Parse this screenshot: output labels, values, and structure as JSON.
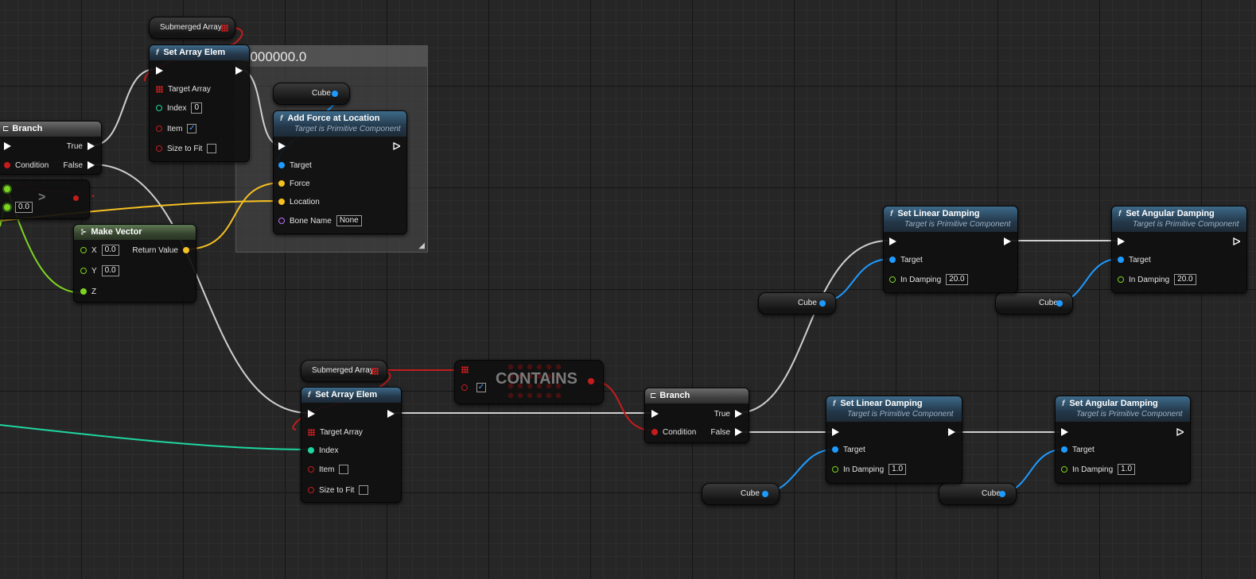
{
  "comment_box": {
    "title": "1000000.0"
  },
  "nodes": {
    "submerged_array_top": {
      "label": "Submerged Array"
    },
    "set_array_elem_top": {
      "title": "Set Array Elem",
      "pins": {
        "target_array": "Target Array",
        "index": "Index",
        "item": "Item",
        "size_to_fit": "Size to Fit"
      },
      "index_value": "0",
      "item_checked": "✓",
      "size_to_fit_checked": ""
    },
    "cube_top": {
      "label": "Cube"
    },
    "add_force": {
      "title": "Add Force at Location",
      "subtitle": "Target is Primitive Component",
      "pins": {
        "target": "Target",
        "force": "Force",
        "location": "Location",
        "bone_name": "Bone Name"
      },
      "bone_name_value": "None"
    },
    "branch_left": {
      "title": "Branch",
      "pins": {
        "true": "True",
        "condition": "Condition",
        "false": "False"
      }
    },
    "compare_node": {
      "value": "0.0",
      "symbol": ">"
    },
    "make_vector": {
      "title": "Make Vector",
      "pins": {
        "x": "X",
        "y": "Y",
        "z": "Z",
        "return_value": "Return Value"
      },
      "x_value": "0.0",
      "y_value": "0.0"
    },
    "submerged_array_bottom": {
      "label": "Submerged Array"
    },
    "contains": {
      "label": "CONTAINS",
      "checked": "✓"
    },
    "set_array_elem_bottom": {
      "title": "Set Array Elem",
      "pins": {
        "target_array": "Target Array",
        "index": "Index",
        "item": "Item",
        "size_to_fit": "Size to Fit"
      },
      "item_checked": "",
      "size_to_fit_checked": ""
    },
    "branch_right": {
      "title": "Branch",
      "pins": {
        "true": "True",
        "condition": "Condition",
        "false": "False"
      }
    },
    "set_linear_damping_top": {
      "title": "Set Linear Damping",
      "subtitle": "Target is Primitive Component",
      "pins": {
        "target": "Target",
        "in_damping": "In Damping"
      },
      "damping_value": "20.0"
    },
    "set_angular_damping_top": {
      "title": "Set Angular Damping",
      "subtitle": "Target is Primitive Component",
      "pins": {
        "target": "Target",
        "in_damping": "In Damping"
      },
      "damping_value": "20.0"
    },
    "set_linear_damping_bottom": {
      "title": "Set Linear Damping",
      "subtitle": "Target is Primitive Component",
      "pins": {
        "target": "Target",
        "in_damping": "In Damping"
      },
      "damping_value": "1.0"
    },
    "set_angular_damping_bottom": {
      "title": "Set Angular Damping",
      "subtitle": "Target is Primitive Component",
      "pins": {
        "target": "Target",
        "in_damping": "In Damping"
      },
      "damping_value": "1.0"
    },
    "cube_linear_top": {
      "label": "Cube"
    },
    "cube_angular_top": {
      "label": "Cube"
    },
    "cube_linear_bottom": {
      "label": "Cube"
    },
    "cube_angular_bottom": {
      "label": "Cube"
    }
  },
  "colors": {
    "exec": "#ffffff",
    "object": "#1e9bff",
    "vector": "#f5c022",
    "bool": "#c41c1c",
    "integer": "#1fd6a0",
    "float": "#7ed321",
    "name": "#c070ff",
    "array": "#d31d1d"
  }
}
